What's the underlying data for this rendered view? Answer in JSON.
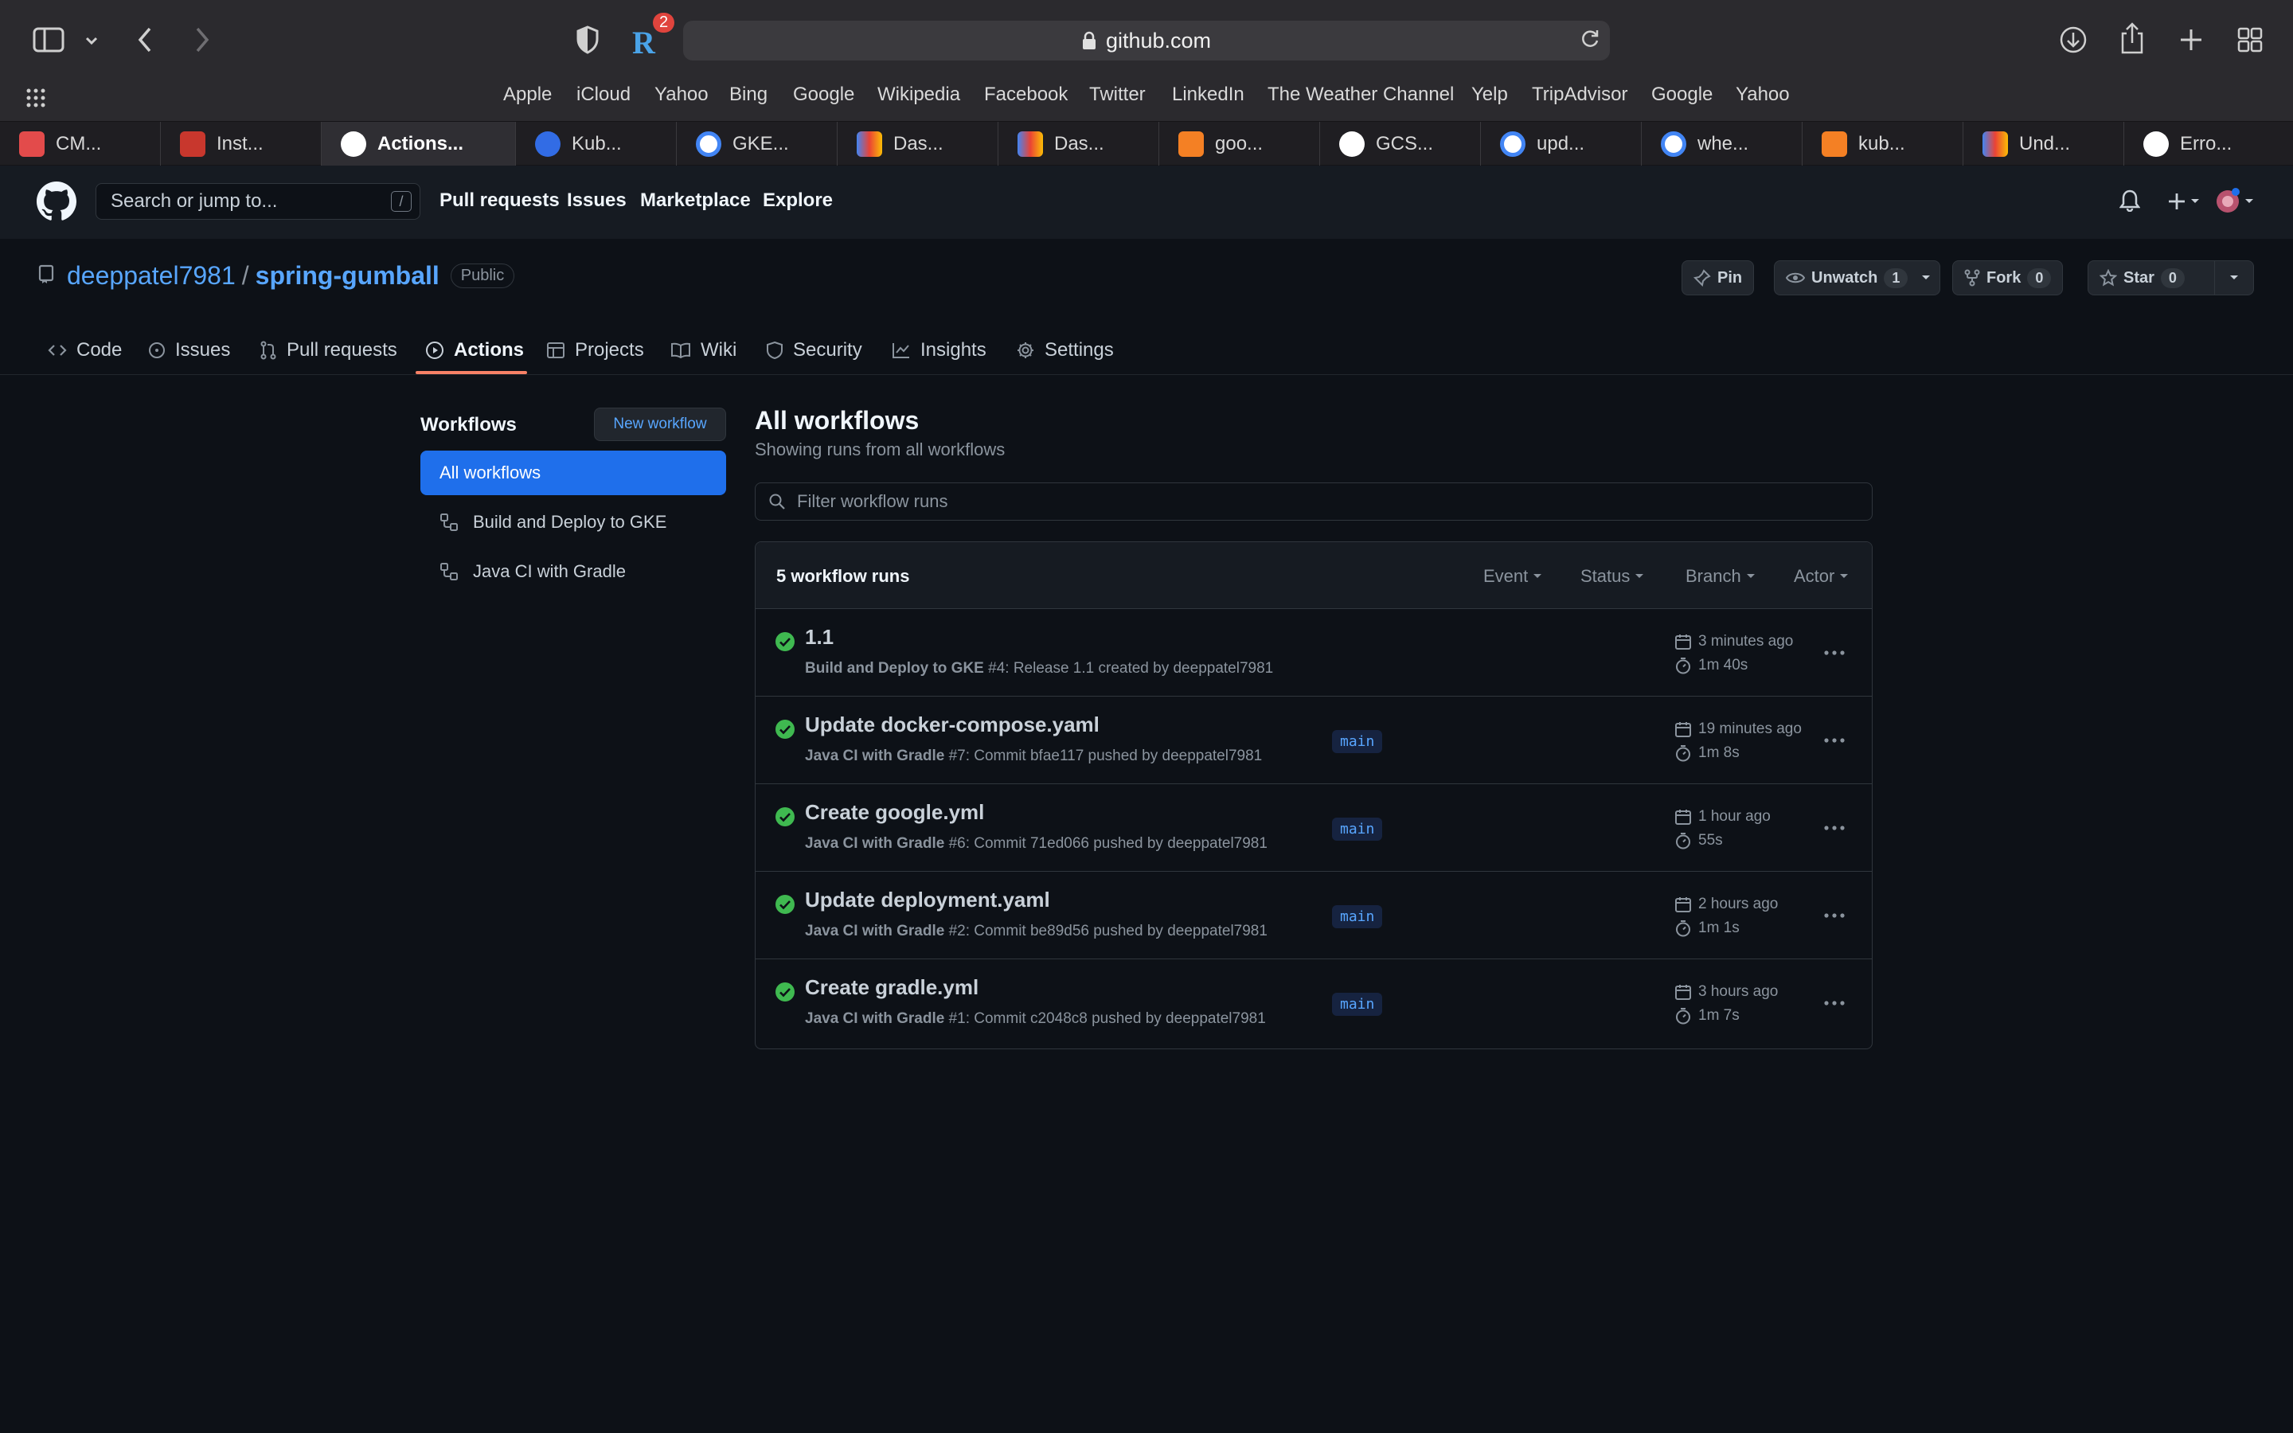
{
  "browser": {
    "url": "github.com",
    "tracker_badge": "2",
    "bookmarks": [
      "Apple",
      "iCloud",
      "Yahoo",
      "Bing",
      "Google",
      "Wikipedia",
      "Facebook",
      "Twitter",
      "LinkedIn",
      "The Weather Channel",
      "Yelp",
      "TripAdvisor",
      "Google",
      "Yahoo"
    ],
    "tabs": [
      {
        "label": "CM...",
        "color": "#e34b4b"
      },
      {
        "label": "Inst...",
        "color": "#c8372d"
      },
      {
        "label": "Actions...",
        "color": "#ffffff"
      },
      {
        "label": "Kub...",
        "color": "#326ce5"
      },
      {
        "label": "GKE...",
        "color": "#4285f4"
      },
      {
        "label": "Das...",
        "color": "#4285f4"
      },
      {
        "label": "Das...",
        "color": "#4285f4"
      },
      {
        "label": "goo...",
        "color": "#f48024"
      },
      {
        "label": "GCS...",
        "color": "#ffffff"
      },
      {
        "label": "upd...",
        "color": "#4285f4"
      },
      {
        "label": "whe...",
        "color": "#4285f4"
      },
      {
        "label": "kub...",
        "color": "#f48024"
      },
      {
        "label": "Und...",
        "color": "#4285f4"
      },
      {
        "label": "Erro...",
        "color": "#ffffff"
      }
    ]
  },
  "header": {
    "search_placeholder": "Search or jump to...",
    "search_shortcut": "/",
    "nav": [
      "Pull requests",
      "Issues",
      "Marketplace",
      "Explore"
    ]
  },
  "repo": {
    "owner": "deeppatel7981",
    "separator": "/",
    "name": "spring-gumball",
    "visibility": "Public",
    "pin_label": "Pin",
    "unwatch_label": "Unwatch",
    "watch_count": "1",
    "fork_label": "Fork",
    "fork_count": "0",
    "star_label": "Star",
    "star_count": "0",
    "tabs": [
      "Code",
      "Issues",
      "Pull requests",
      "Actions",
      "Projects",
      "Wiki",
      "Security",
      "Insights",
      "Settings"
    ]
  },
  "sidebar": {
    "title": "Workflows",
    "new_workflow": "New workflow",
    "items": [
      "All workflows",
      "Build and Deploy to GKE",
      "Java CI with Gradle"
    ]
  },
  "main": {
    "title": "All workflows",
    "subtitle": "Showing runs from all workflows",
    "filter_placeholder": "Filter workflow runs",
    "runs_count": "5 workflow runs",
    "filters": [
      "Event",
      "Status",
      "Branch",
      "Actor"
    ],
    "runs": [
      {
        "title": "1.1",
        "workflow": "Build and Deploy to GKE",
        "detail": " #4: Release 1.1 created by deeppatel7981",
        "branch": "",
        "time": "3 minutes ago",
        "duration": "1m 40s"
      },
      {
        "title": "Update docker-compose.yaml",
        "workflow": "Java CI with Gradle",
        "detail": " #7: Commit bfae117 pushed by deeppatel7981",
        "branch": "main",
        "time": "19 minutes ago",
        "duration": "1m 8s"
      },
      {
        "title": "Create google.yml",
        "workflow": "Java CI with Gradle",
        "detail": " #6: Commit 71ed066 pushed by deeppatel7981",
        "branch": "main",
        "time": "1 hour ago",
        "duration": "55s"
      },
      {
        "title": "Update deployment.yaml",
        "workflow": "Java CI with Gradle",
        "detail": " #2: Commit be89d56 pushed by deeppatel7981",
        "branch": "main",
        "time": "2 hours ago",
        "duration": "1m 1s"
      },
      {
        "title": "Create gradle.yml",
        "workflow": "Java CI with Gradle",
        "detail": " #1: Commit c2048c8 pushed by deeppatel7981",
        "branch": "main",
        "time": "3 hours ago",
        "duration": "1m 7s"
      }
    ]
  }
}
